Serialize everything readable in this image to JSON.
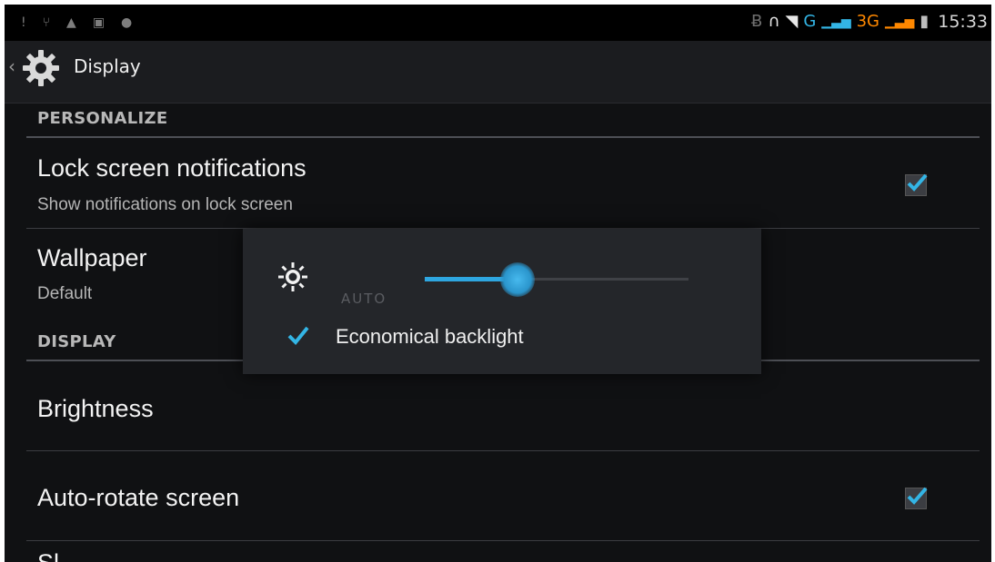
{
  "status_bar": {
    "left_icons": [
      "exclamation-icon",
      "usb-icon",
      "lock-icon",
      "image-icon",
      "chat-icon"
    ],
    "right_icons": [
      "bluetooth-icon",
      "headset-icon",
      "wifi-icon",
      "signal-g-icon",
      "signal-3g-icon",
      "battery-icon"
    ],
    "network_g": "G",
    "network_3g": "3G",
    "time": "15:33"
  },
  "action_bar": {
    "title": "Display"
  },
  "sections": {
    "personalize_header": "PERSONALIZE",
    "lock_screen": {
      "title": "Lock screen notifications",
      "summary": "Show notifications on lock screen",
      "checked": true
    },
    "wallpaper": {
      "title": "Wallpaper",
      "summary": "Default"
    },
    "display_header": "DISPLAY",
    "brightness": {
      "title": "Brightness"
    },
    "auto_rotate": {
      "title": "Auto-rotate screen",
      "checked": true
    },
    "next_item_partial": "Sl"
  },
  "brightness_dialog": {
    "auto_label": "AUTO",
    "level_fraction": 0.35,
    "economical_backlight_label": "Economical backlight",
    "economical_backlight_checked": true
  },
  "colors": {
    "accent": "#33b5e5",
    "background": "#101113",
    "status_green": "#7fbf3f",
    "status_blue": "#33b5e5",
    "status_orange": "#ff8800"
  }
}
